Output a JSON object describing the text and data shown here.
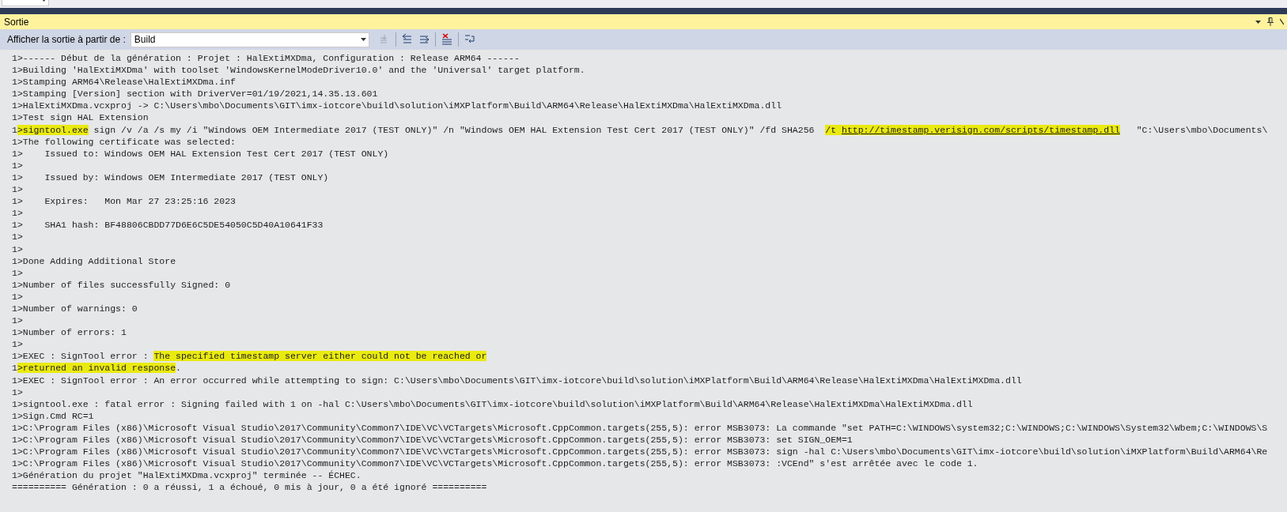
{
  "panel": {
    "title": "Sortie"
  },
  "toolbar": {
    "label": "Afficher la sortie à partir de :",
    "source": "Build",
    "buttons": [
      {
        "kind": "goto",
        "disabled": true
      },
      {
        "kind": "prev",
        "disabled": false
      },
      {
        "kind": "next",
        "disabled": false
      },
      {
        "kind": "clear",
        "disabled": false
      },
      {
        "kind": "wrap",
        "disabled": false
      }
    ]
  },
  "output_lines": [
    [
      {
        "text": "1>------ Début de la génération : Projet : HalExtiMXDma, Configuration : Release ARM64 ------"
      }
    ],
    [
      {
        "text": "1>Building 'HalExtiMXDma' with toolset 'WindowsKernelModeDriver10.0' and the 'Universal' target platform."
      }
    ],
    [
      {
        "text": "1>Stamping ARM64\\Release\\HalExtiMXDma.inf"
      }
    ],
    [
      {
        "text": "1>Stamping [Version] section with DriverVer=01/19/2021,14.35.13.601"
      }
    ],
    [
      {
        "text": "1>HalExtiMXDma.vcxproj -> C:\\Users\\mbo\\Documents\\GIT\\imx-iotcore\\build\\solution\\iMXPlatform\\Build\\ARM64\\Release\\HalExtiMXDma\\HalExtiMXDma.dll"
      }
    ],
    [
      {
        "text": "1>Test sign HAL Extension"
      }
    ],
    [
      {
        "text": "1"
      },
      {
        "text": ">signtool.exe",
        "highlighted": true
      },
      {
        "text": " sign /v /a /s my /i \"Windows OEM Intermediate 2017 (TEST ONLY)\" /n \"Windows OEM HAL Extension Test Cert 2017 (TEST ONLY)\" /fd SHA256  "
      },
      {
        "text": "/t ",
        "highlighted": true
      },
      {
        "text": "http://timestamp.verisign.com/scripts/timestamp.dll",
        "highlighted": true,
        "kind": "link"
      },
      {
        "text": "   \"C:\\Users\\mbo\\Documents\\"
      }
    ],
    [
      {
        "text": "1>The following certificate was selected:"
      }
    ],
    [
      {
        "text": "1>    Issued to: Windows OEM HAL Extension Test Cert 2017 (TEST ONLY)"
      }
    ],
    [
      {
        "text": "1>"
      }
    ],
    [
      {
        "text": "1>    Issued by: Windows OEM Intermediate 2017 (TEST ONLY)"
      }
    ],
    [
      {
        "text": "1>"
      }
    ],
    [
      {
        "text": "1>    Expires:   Mon Mar 27 23:25:16 2023"
      }
    ],
    [
      {
        "text": "1>"
      }
    ],
    [
      {
        "text": "1>    SHA1 hash: BF48806CBDD77D6E6C5DE54050C5D40A10641F33"
      }
    ],
    [
      {
        "text": "1>"
      }
    ],
    [
      {
        "text": "1>"
      }
    ],
    [
      {
        "text": "1>Done Adding Additional Store"
      }
    ],
    [
      {
        "text": "1>"
      }
    ],
    [
      {
        "text": "1>Number of files successfully Signed: 0"
      }
    ],
    [
      {
        "text": "1>"
      }
    ],
    [
      {
        "text": "1>Number of warnings: 0"
      }
    ],
    [
      {
        "text": "1>"
      }
    ],
    [
      {
        "text": "1>Number of errors: 1"
      }
    ],
    [
      {
        "text": "1>"
      }
    ],
    [
      {
        "text": "1>EXEC : SignTool error : "
      },
      {
        "text": "The specified timestamp server either could not be reached or",
        "highlighted": true
      }
    ],
    [
      {
        "text": "1"
      },
      {
        "text": ">returned an invalid response",
        "highlighted": true
      },
      {
        "text": "."
      }
    ],
    [
      {
        "text": "1>EXEC : SignTool error : An error occurred while attempting to sign: C:\\Users\\mbo\\Documents\\GIT\\imx-iotcore\\build\\solution\\iMXPlatform\\Build\\ARM64\\Release\\HalExtiMXDma\\HalExtiMXDma.dll"
      }
    ],
    [
      {
        "text": "1>"
      }
    ],
    [
      {
        "text": "1>signtool.exe : fatal error : Signing failed with 1 on -hal C:\\Users\\mbo\\Documents\\GIT\\imx-iotcore\\build\\solution\\iMXPlatform\\Build\\ARM64\\Release\\HalExtiMXDma\\HalExtiMXDma.dll"
      }
    ],
    [
      {
        "text": "1>Sign.Cmd RC=1"
      }
    ],
    [
      {
        "text": "1>C:\\Program Files (x86)\\Microsoft Visual Studio\\2017\\Community\\Common7\\IDE\\VC\\VCTargets\\Microsoft.CppCommon.targets(255,5): error MSB3073: La commande \"set PATH=C:\\WINDOWS\\system32;C:\\WINDOWS;C:\\WINDOWS\\System32\\Wbem;C:\\WINDOWS\\S"
      }
    ],
    [
      {
        "text": "1>C:\\Program Files (x86)\\Microsoft Visual Studio\\2017\\Community\\Common7\\IDE\\VC\\VCTargets\\Microsoft.CppCommon.targets(255,5): error MSB3073: set SIGN_OEM=1"
      }
    ],
    [
      {
        "text": "1>C:\\Program Files (x86)\\Microsoft Visual Studio\\2017\\Community\\Common7\\IDE\\VC\\VCTargets\\Microsoft.CppCommon.targets(255,5): error MSB3073: sign -hal C:\\Users\\mbo\\Documents\\GIT\\imx-iotcore\\build\\solution\\iMXPlatform\\Build\\ARM64\\Re"
      }
    ],
    [
      {
        "text": "1>C:\\Program Files (x86)\\Microsoft Visual Studio\\2017\\Community\\Common7\\IDE\\VC\\VCTargets\\Microsoft.CppCommon.targets(255,5): error MSB3073: :VCEnd\" s'est arrêtée avec le code 1."
      }
    ],
    [
      {
        "text": "1>Génération du projet \"HalExtiMXDma.vcxproj\" terminée -- ÉCHEC."
      }
    ],
    [
      {
        "text": "========== Génération : 0 a réussi, 1 a échoué, 0 mis à jour, 0 a été ignoré =========="
      }
    ]
  ]
}
